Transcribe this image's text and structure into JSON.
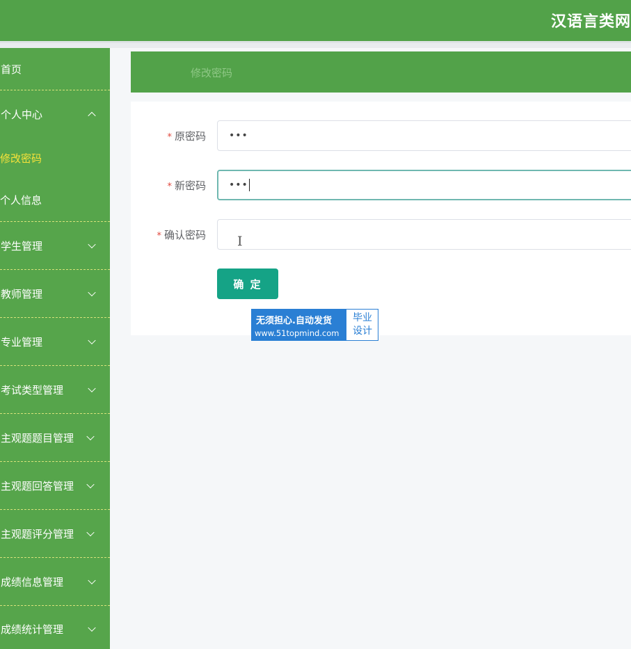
{
  "header": {
    "title": "汉语言类网"
  },
  "sidebar": {
    "items": [
      {
        "label": "首页"
      },
      {
        "label": "个人中心",
        "expanded": true,
        "children": [
          {
            "label": "修改密码",
            "active": true
          },
          {
            "label": "个人信息"
          }
        ]
      },
      {
        "label": "学生管理"
      },
      {
        "label": "教师管理"
      },
      {
        "label": "专业管理"
      },
      {
        "label": "考试类型管理"
      },
      {
        "label": "主观题题目管理"
      },
      {
        "label": "主观题回答管理"
      },
      {
        "label": "主观题评分管理"
      },
      {
        "label": "成绩信息管理"
      },
      {
        "label": "成绩统计管理"
      }
    ]
  },
  "breadcrumb": {
    "current": "修改密码"
  },
  "form": {
    "required_mark": "*",
    "fields": [
      {
        "label": "原密码",
        "value": "•••",
        "focused": false
      },
      {
        "label": "新密码",
        "value": "•••",
        "focused": true
      },
      {
        "label": "确认密码",
        "value": "",
        "focused": false
      }
    ],
    "submit_label": "确 定"
  },
  "watermark": {
    "line1": "无须担心.自动发货",
    "line2": "www.51topmind.com",
    "badge_line1": "毕业",
    "badge_line2": "设计"
  },
  "colors": {
    "primary_green": "#52a249",
    "sidebar_active": "#f6e23a",
    "button_teal": "#15a386",
    "required_red": "#e0483d"
  }
}
